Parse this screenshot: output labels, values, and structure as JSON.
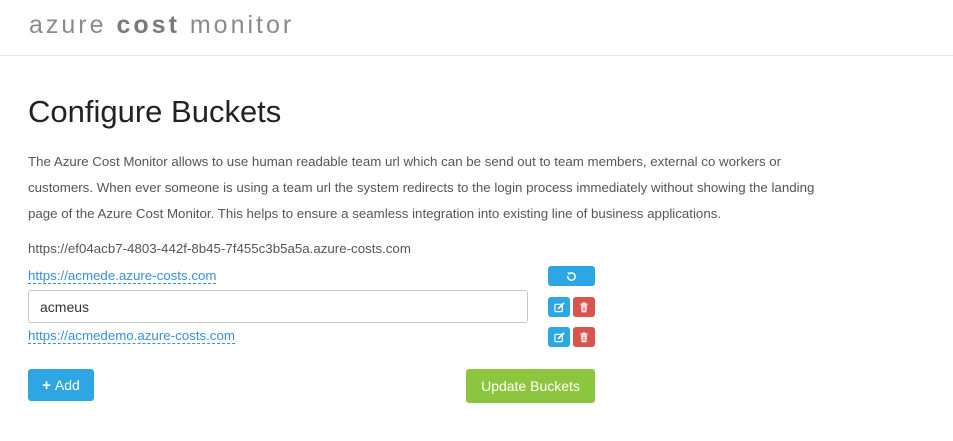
{
  "app": {
    "brand_part1": "azure",
    "brand_part2": "cost",
    "brand_part3": "monitor"
  },
  "page": {
    "title": "Configure Buckets",
    "description": "The Azure Cost Monitor allows to use human readable team url which can be send out to team members, external co workers or customers. When ever someone is using a team url the system redirects to the login process immediately without showing the landing page of the Azure Cost Monitor. This helps to ensure a seamless integration into existing line of business applications.",
    "default_url": "https://ef04acb7-4803-442f-8b45-7f455c3b5a5a.azure-costs.com"
  },
  "buckets": [
    {
      "url": "https://acmede.azure-costs.com",
      "actions": [
        "reset-icon"
      ]
    },
    {
      "input_value": "acmeus",
      "actions": [
        "edit-icon",
        "trash-icon"
      ]
    },
    {
      "url": "https://acmedemo.azure-costs.com",
      "actions": [
        "edit-icon",
        "trash-icon"
      ]
    }
  ],
  "buttons": {
    "add_label": "Add",
    "update_label": "Update Buckets"
  },
  "colors": {
    "primary_blue": "#2ea6e3",
    "danger_red": "#d9534f",
    "success_green": "#8cc63f",
    "link_blue": "#3a8fd6"
  }
}
